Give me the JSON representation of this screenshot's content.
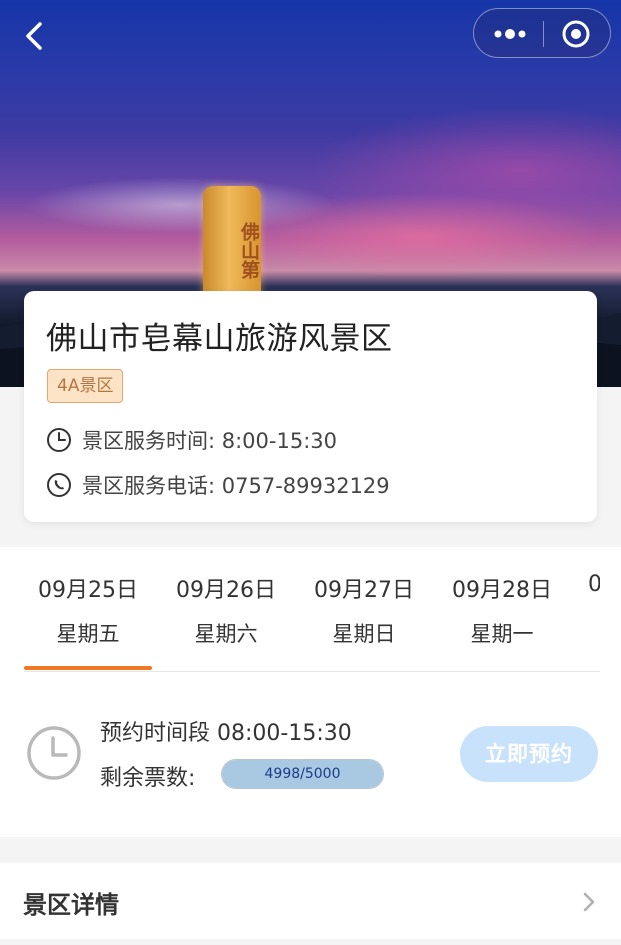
{
  "hero": {
    "stele_text": "佛山第"
  },
  "site": {
    "title": "佛山市皂幕山旅游风景区",
    "level_badge": "4A景区",
    "hours_label": "景区服务时间: 8:00-15:30",
    "phone_label": "景区服务电话: 0757-89932129"
  },
  "dates": [
    {
      "date": "09月25日",
      "weekday": "星期五",
      "selected": true
    },
    {
      "date": "09月26日",
      "weekday": "星期六",
      "selected": false
    },
    {
      "date": "09月27日",
      "weekday": "星期日",
      "selected": false
    },
    {
      "date": "09月28日",
      "weekday": "星期一",
      "selected": false
    },
    {
      "date": "0",
      "weekday": "",
      "selected": false
    }
  ],
  "slot": {
    "period_text": "预约时间段 08:00-15:30",
    "remaining_label": "剩余票数:",
    "remaining_text": "4998/5000",
    "remaining_fraction": 0.9996,
    "book_label": "立即预约"
  },
  "details": {
    "label": "景区详情"
  },
  "colors": {
    "accent": "#f07a22",
    "badge_bg": "#fde3c6",
    "badge_text": "#b77640",
    "button_disabled": "#c9e2fb"
  }
}
